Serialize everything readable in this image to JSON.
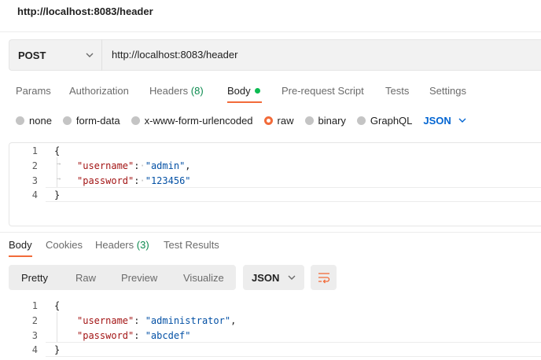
{
  "page": {
    "title": "http://localhost:8083/header"
  },
  "request": {
    "method": "POST",
    "url": "http://localhost:8083/header",
    "tabs": [
      {
        "label": "Params"
      },
      {
        "label": "Authorization"
      },
      {
        "label": "Headers",
        "count": "(8)"
      },
      {
        "label": "Body",
        "active": true,
        "indicator": "green-dot"
      },
      {
        "label": "Pre-request Script"
      },
      {
        "label": "Tests"
      },
      {
        "label": "Settings"
      }
    ],
    "body_types": [
      "none",
      "form-data",
      "x-www-form-urlencoded",
      "raw",
      "binary",
      "GraphQL"
    ],
    "selected_body_type": "raw",
    "language": "JSON",
    "editor": {
      "line_numbers": [
        "1",
        "2",
        "3",
        "4"
      ],
      "open_brace": "{",
      "close_brace": "}",
      "fields": [
        {
          "key": "\"username\"",
          "value": "\"admin\"",
          "trailing": ","
        },
        {
          "key": "\"password\"",
          "value": "\"123456\"",
          "trailing": ""
        }
      ]
    }
  },
  "response": {
    "tabs": [
      {
        "label": "Body",
        "active": true
      },
      {
        "label": "Cookies"
      },
      {
        "label": "Headers",
        "count": "(3)"
      },
      {
        "label": "Test Results"
      }
    ],
    "views": [
      "Pretty",
      "Raw",
      "Preview",
      "Visualize"
    ],
    "active_view": "Pretty",
    "format": "JSON",
    "editor": {
      "line_numbers": [
        "1",
        "2",
        "3",
        "4"
      ],
      "open_brace": "{",
      "close_brace": "}",
      "fields": [
        {
          "key": "\"username\"",
          "value": "\"administrator\"",
          "trailing": ","
        },
        {
          "key": "\"password\"",
          "value": "\"abcdef\"",
          "trailing": ""
        }
      ]
    }
  },
  "colors": {
    "accent": "#f26b3a",
    "link_blue": "#0265d2",
    "json_key": "#a31515",
    "json_string": "#0451a5",
    "count_green": "#0b8a4e",
    "body_dot": "#0cbb52"
  },
  "icons": [
    "chevron-down-icon",
    "wrap-lines-icon"
  ]
}
